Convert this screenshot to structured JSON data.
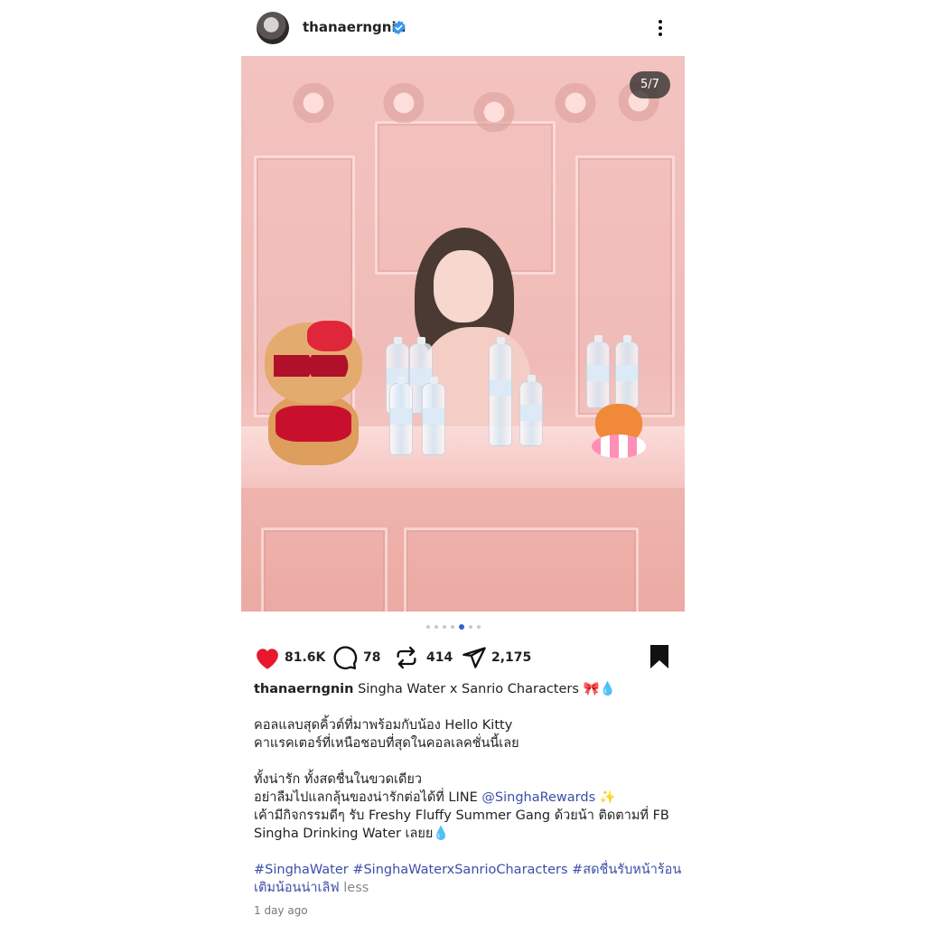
{
  "post": {
    "username": "thanaerngnin",
    "verified": true,
    "image_counter": "5/7",
    "carousel": {
      "total": 7,
      "active_index": 4
    },
    "image_description_icon": "photo"
  },
  "actions": {
    "likes": "81.6K",
    "comments": "78",
    "reposts": "414",
    "shares": "2,175",
    "liked": true,
    "saved": true
  },
  "caption": {
    "username": "thanaerngnin",
    "title": "Singha Water x Sanrio Characters 🎀💧",
    "line1": "คอลแลบสุดคิ้วต์ที่มาพร้อมกับน้อง Hello Kitty",
    "line2": "คาแรคเตอร์ที่เหนือชอบที่สุดในคอลเลคชั่นนี้เลย",
    "line3": "ทั้งน่ารัก ทั้งสดชื่นในขวดเดียว",
    "line4_prefix": "อย่าลืมไปแลกลุ้นของน่ารักต่อได้ที่ LINE ",
    "line4_link": "@SinghaRewards",
    "line4_suffix": " ✨",
    "line5": "เค้ามีกิจกรรมดีๆ รับ Freshy Fluffy Summer Gang ด้วยน้า ติดตามที่ FB",
    "line6": "Singha Drinking Water เลยย💧",
    "hashtags_line1": "#SinghaWater #SinghaWaterxSanrioCharacters #สดชื่นรับหน้าร้อน",
    "hashtags_line2": "เติมน้อนน่าเลิฟ",
    "less_label": "less"
  },
  "timestamp": "1 day ago",
  "colors": {
    "like_red": "#e8192c",
    "link_blue": "#3b4ea8",
    "verified_blue": "#3897f0",
    "active_dot": "#3b5bdb"
  }
}
